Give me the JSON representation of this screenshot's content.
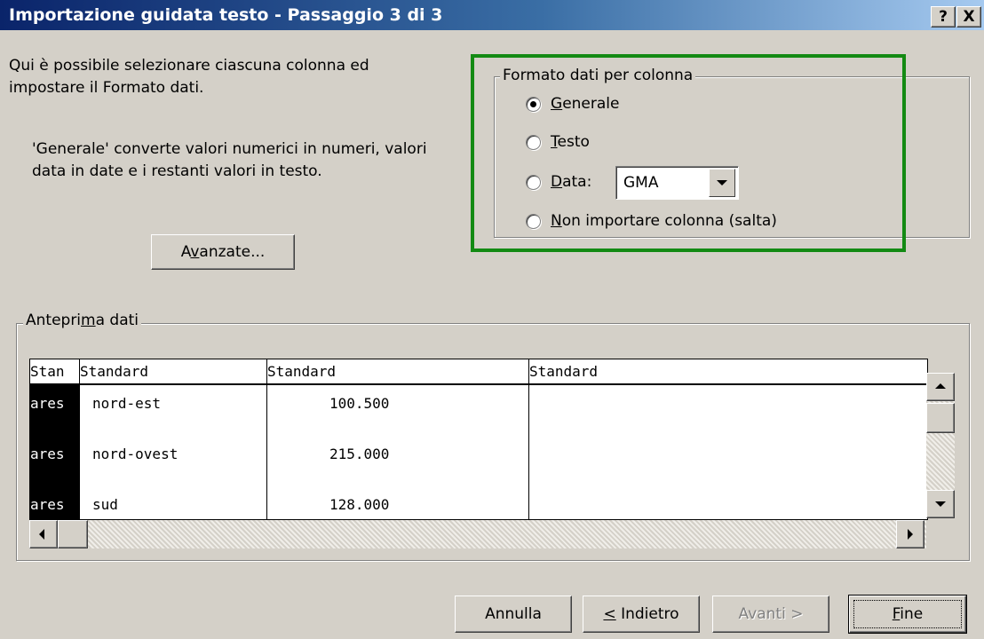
{
  "window": {
    "title": "Importazione guidata testo - Passaggio 3 di 3",
    "help_button": "?",
    "close_button": "X"
  },
  "instructions": {
    "line1": "Qui è possibile selezionare ciascuna colonna ed",
    "line2": "impostare il Formato dati.",
    "desc_line1": "'Generale' converte valori numerici in numeri, valori",
    "desc_line2": "data in date e i restanti valori in testo."
  },
  "advanced_button": {
    "pre": "A",
    "key": "v",
    "post": "anzate..."
  },
  "format_group": {
    "legend": "Formato dati per colonna",
    "options": [
      {
        "key": "G",
        "rest": "enerale",
        "checked": true
      },
      {
        "key": "T",
        "rest": "esto",
        "checked": false
      },
      {
        "key": "D",
        "rest": "ata:",
        "checked": false
      },
      {
        "key": "N",
        "rest": "on importare colonna (salta)",
        "checked": false
      }
    ],
    "date_format": "GMA"
  },
  "preview": {
    "legend_pre": "Antepri",
    "legend_key": "m",
    "legend_post": "a dati",
    "headers": [
      "Stan",
      "Standard",
      "Standard",
      "Standard"
    ],
    "rows": [
      [
        "ares",
        "nord-est",
        "100.500",
        ""
      ],
      [
        "ares",
        "nord-ovest",
        "215.000",
        ""
      ],
      [
        "ares",
        "sud",
        "128.000",
        ""
      ]
    ]
  },
  "buttons": {
    "cancel": "Annulla",
    "back_key": "<",
    "back_rest": " Indietro",
    "next": "Avanti >",
    "finish_key": "F",
    "finish_rest": "ine"
  },
  "colors": {
    "highlight_box": "#138a13",
    "titlebar": "#0a246a"
  }
}
